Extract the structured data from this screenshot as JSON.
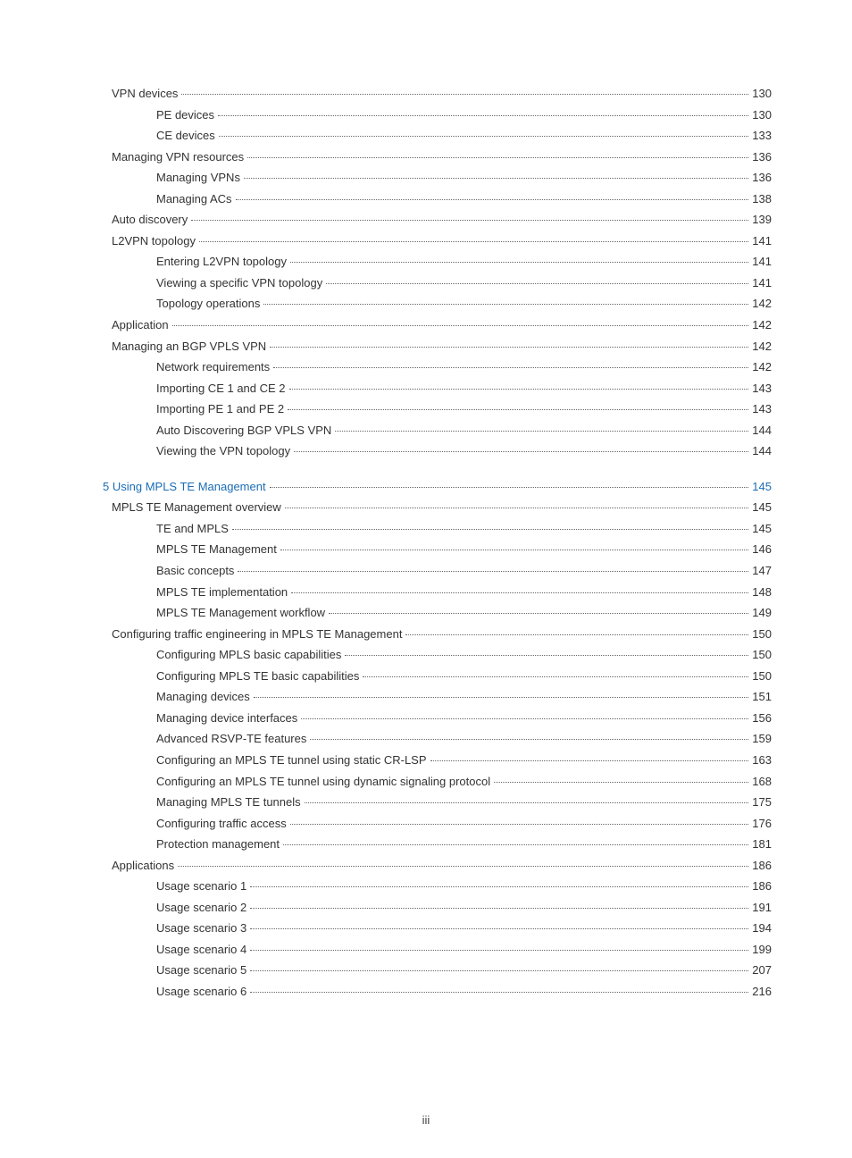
{
  "page_number_label": "iii",
  "entries": [
    {
      "label": "VPN devices",
      "page": "130",
      "level": 1,
      "link": false
    },
    {
      "label": "PE devices",
      "page": "130",
      "level": 2,
      "link": false
    },
    {
      "label": "CE devices",
      "page": "133",
      "level": 2,
      "link": false
    },
    {
      "label": "Managing VPN resources",
      "page": "136",
      "level": 1,
      "link": false
    },
    {
      "label": "Managing VPNs",
      "page": "136",
      "level": 2,
      "link": false
    },
    {
      "label": "Managing ACs",
      "page": "138",
      "level": 2,
      "link": false
    },
    {
      "label": "Auto discovery",
      "page": "139",
      "level": 1,
      "link": false
    },
    {
      "label": "L2VPN topology",
      "page": "141",
      "level": 1,
      "link": false
    },
    {
      "label": "Entering L2VPN topology",
      "page": "141",
      "level": 2,
      "link": false
    },
    {
      "label": "Viewing a specific VPN topology",
      "page": "141",
      "level": 2,
      "link": false
    },
    {
      "label": "Topology operations",
      "page": "142",
      "level": 2,
      "link": false
    },
    {
      "label": "Application",
      "page": "142",
      "level": 1,
      "link": false
    },
    {
      "label": "Managing an BGP VPLS VPN",
      "page": "142",
      "level": 1,
      "link": false
    },
    {
      "label": "Network requirements",
      "page": "142",
      "level": 2,
      "link": false
    },
    {
      "label": "Importing CE 1 and CE 2",
      "page": "143",
      "level": 2,
      "link": false
    },
    {
      "label": "Importing PE 1 and PE 2",
      "page": "143",
      "level": 2,
      "link": false
    },
    {
      "label": "Auto Discovering BGP VPLS VPN",
      "page": "144",
      "level": 2,
      "link": false
    },
    {
      "label": "Viewing the VPN topology",
      "page": "144",
      "level": 2,
      "link": false
    },
    {
      "gap": true
    },
    {
      "label": "5 Using MPLS TE Management",
      "page": "145",
      "level": 0,
      "link": true
    },
    {
      "label": "MPLS TE Management overview",
      "page": "145",
      "level": 1,
      "link": false
    },
    {
      "label": "TE and MPLS",
      "page": "145",
      "level": 2,
      "link": false
    },
    {
      "label": "MPLS TE Management",
      "page": "146",
      "level": 2,
      "link": false
    },
    {
      "label": "Basic concepts",
      "page": "147",
      "level": 2,
      "link": false
    },
    {
      "label": "MPLS TE implementation",
      "page": "148",
      "level": 2,
      "link": false
    },
    {
      "label": "MPLS TE Management workflow",
      "page": "149",
      "level": 2,
      "link": false
    },
    {
      "label": "Configuring traffic engineering in MPLS TE Management",
      "page": "150",
      "level": 1,
      "link": false
    },
    {
      "label": "Configuring MPLS basic capabilities",
      "page": "150",
      "level": 2,
      "link": false
    },
    {
      "label": "Configuring MPLS TE basic capabilities",
      "page": "150",
      "level": 2,
      "link": false
    },
    {
      "label": "Managing devices",
      "page": "151",
      "level": 2,
      "link": false
    },
    {
      "label": "Managing device interfaces",
      "page": "156",
      "level": 2,
      "link": false
    },
    {
      "label": "Advanced RSVP-TE features",
      "page": "159",
      "level": 2,
      "link": false
    },
    {
      "label": "Configuring an MPLS TE tunnel using static CR-LSP",
      "page": "163",
      "level": 2,
      "link": false
    },
    {
      "label": "Configuring an MPLS TE tunnel using dynamic signaling protocol",
      "page": "168",
      "level": 2,
      "link": false
    },
    {
      "label": "Managing MPLS TE tunnels",
      "page": "175",
      "level": 2,
      "link": false
    },
    {
      "label": "Configuring traffic access",
      "page": "176",
      "level": 2,
      "link": false
    },
    {
      "label": "Protection management",
      "page": "181",
      "level": 2,
      "link": false
    },
    {
      "label": "Applications",
      "page": "186",
      "level": 1,
      "link": false
    },
    {
      "label": "Usage scenario 1",
      "page": "186",
      "level": 2,
      "link": false
    },
    {
      "label": "Usage scenario 2",
      "page": "191",
      "level": 2,
      "link": false
    },
    {
      "label": "Usage scenario 3",
      "page": "194",
      "level": 2,
      "link": false
    },
    {
      "label": "Usage scenario 4",
      "page": "199",
      "level": 2,
      "link": false
    },
    {
      "label": "Usage scenario 5",
      "page": "207",
      "level": 2,
      "link": false
    },
    {
      "label": "Usage scenario 6",
      "page": "216",
      "level": 2,
      "link": false
    }
  ]
}
